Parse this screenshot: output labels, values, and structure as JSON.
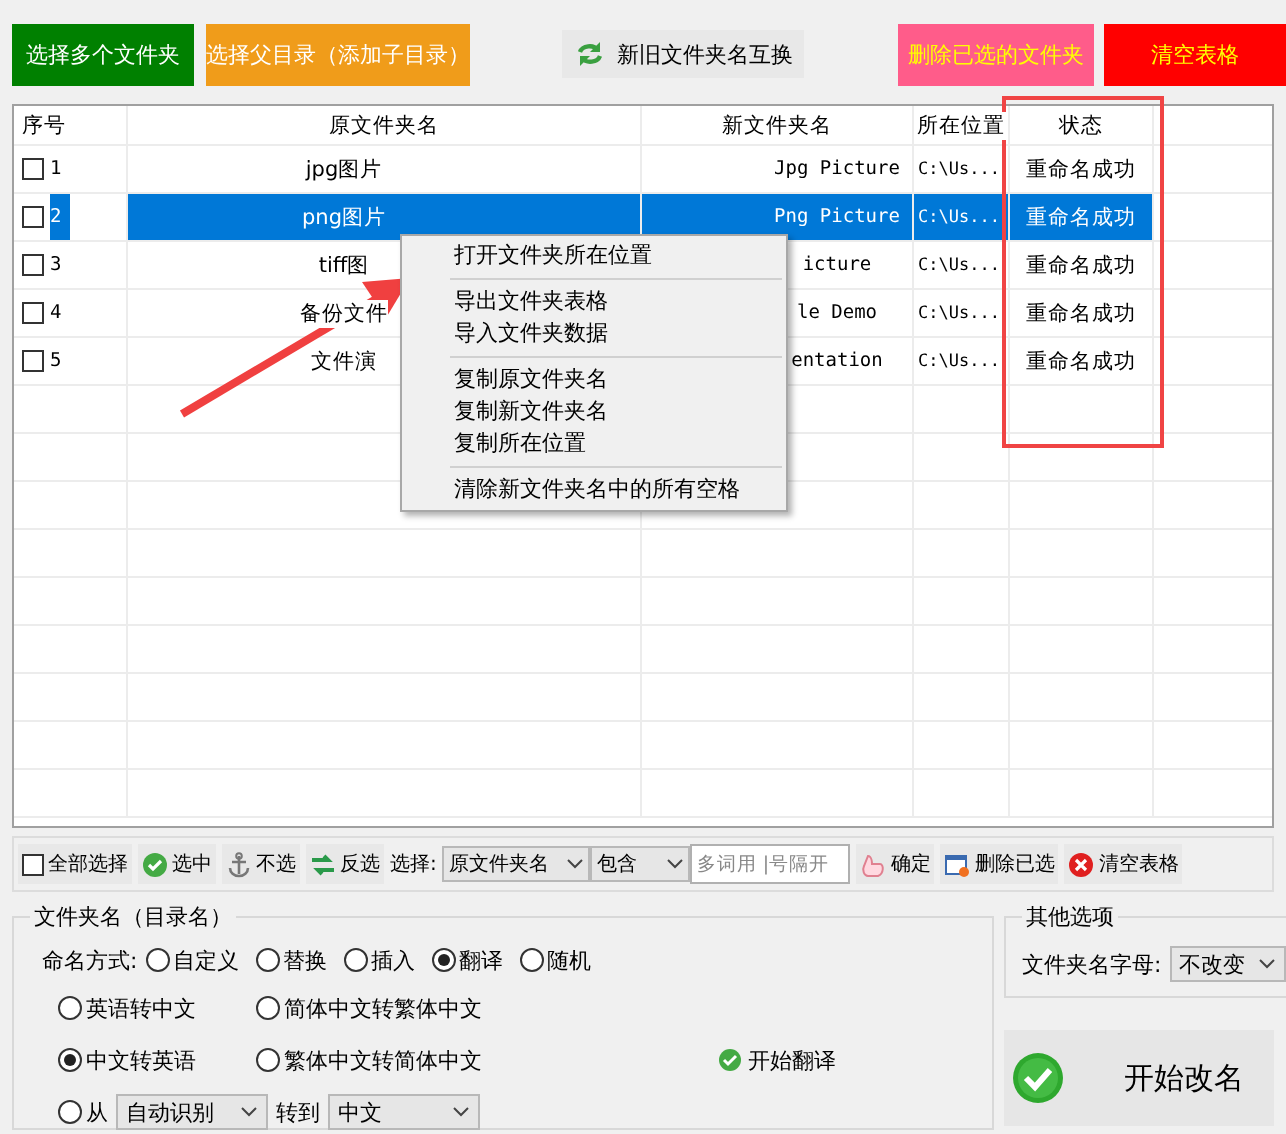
{
  "top_buttons": [
    {
      "label": "选择多个文件夹",
      "kind": "solid",
      "color": "#008000"
    },
    {
      "label": "选择父目录（添加子目录）",
      "kind": "solid",
      "color": "#f09c1a"
    },
    {
      "label": "新旧文件夹名互换",
      "kind": "swap",
      "color": "#e8e8e8"
    },
    {
      "label": "删除已选的文件夹",
      "kind": "warning",
      "color": "#ff5c8a"
    },
    {
      "label": "清空表格",
      "kind": "warning",
      "color": "#ff0000"
    }
  ],
  "table": {
    "columns": [
      "序号",
      "原文件夹名",
      "新文件夹名",
      "所在位置",
      "状态"
    ],
    "rows": [
      {
        "checked": false,
        "selected": false,
        "cells": [
          "1",
          "jpg图片",
          "Jpg Picture",
          "C:\\Us...",
          "重命名成功"
        ]
      },
      {
        "checked": false,
        "selected": true,
        "cells": [
          "2",
          "png图片",
          "Png Picture",
          "C:\\Us...",
          "重命名成功"
        ]
      },
      {
        "checked": false,
        "selected": false,
        "cells": [
          "3",
          "tiff图",
          "icture",
          "C:\\Us...",
          "重命名成功"
        ]
      },
      {
        "checked": false,
        "selected": false,
        "cells": [
          "4",
          "备份文件",
          "le Demo",
          "C:\\Us...",
          "重命名成功"
        ]
      },
      {
        "checked": false,
        "selected": false,
        "cells": [
          "5",
          "文件演",
          "entation",
          "C:\\Us...",
          "重命名成功"
        ]
      }
    ]
  },
  "context_menu": {
    "groups": [
      [
        "打开文件夹所在位置"
      ],
      [
        "导出文件夹表格",
        "导入文件夹数据"
      ],
      [
        "复制原文件夹名",
        "复制新文件夹名",
        "复制所在位置"
      ],
      [
        "清除新文件夹名中的所有空格"
      ]
    ]
  },
  "toolbar": {
    "select_all": {
      "label": "全部选择",
      "checked": false
    },
    "items": [
      {
        "kind": "select",
        "label": "选中"
      },
      {
        "kind": "deselect",
        "label": "不选"
      },
      {
        "kind": "invert",
        "label": "反选"
      }
    ],
    "filter_label": "选择:",
    "filter_field": "原文件夹名",
    "filter_mode": "包含",
    "filter_placeholder": "多词用 |号隔开",
    "actions": [
      {
        "kind": "confirm",
        "label": "确定"
      },
      {
        "kind": "delete",
        "label": "删除已选"
      },
      {
        "kind": "clear",
        "label": "清空表格"
      }
    ]
  },
  "rename": {
    "title": "文件夹名（目录名）",
    "method_label": "命名方式:",
    "methods": [
      {
        "label": "自定义",
        "selected": false
      },
      {
        "label": "替换",
        "selected": false
      },
      {
        "label": "插入",
        "selected": false
      },
      {
        "label": "翻译",
        "selected": true
      },
      {
        "label": "随机",
        "selected": false
      }
    ],
    "translate_options": [
      {
        "label": "英语转中文",
        "selected": false
      },
      {
        "label": "简体中文转繁体中文",
        "selected": false
      },
      {
        "label": "中文转英语",
        "selected": true
      },
      {
        "label": "繁体中文转简体中文",
        "selected": false
      }
    ],
    "from": {
      "label": "从",
      "selected": false,
      "source": "自动识别",
      "to_label": "转到",
      "target": "中文"
    },
    "start_translate": "开始翻译"
  },
  "other_options": {
    "title": "其他选项",
    "letter_label": "文件夹名字母:",
    "letter_value": "不改变"
  },
  "start_rename": "开始改名"
}
